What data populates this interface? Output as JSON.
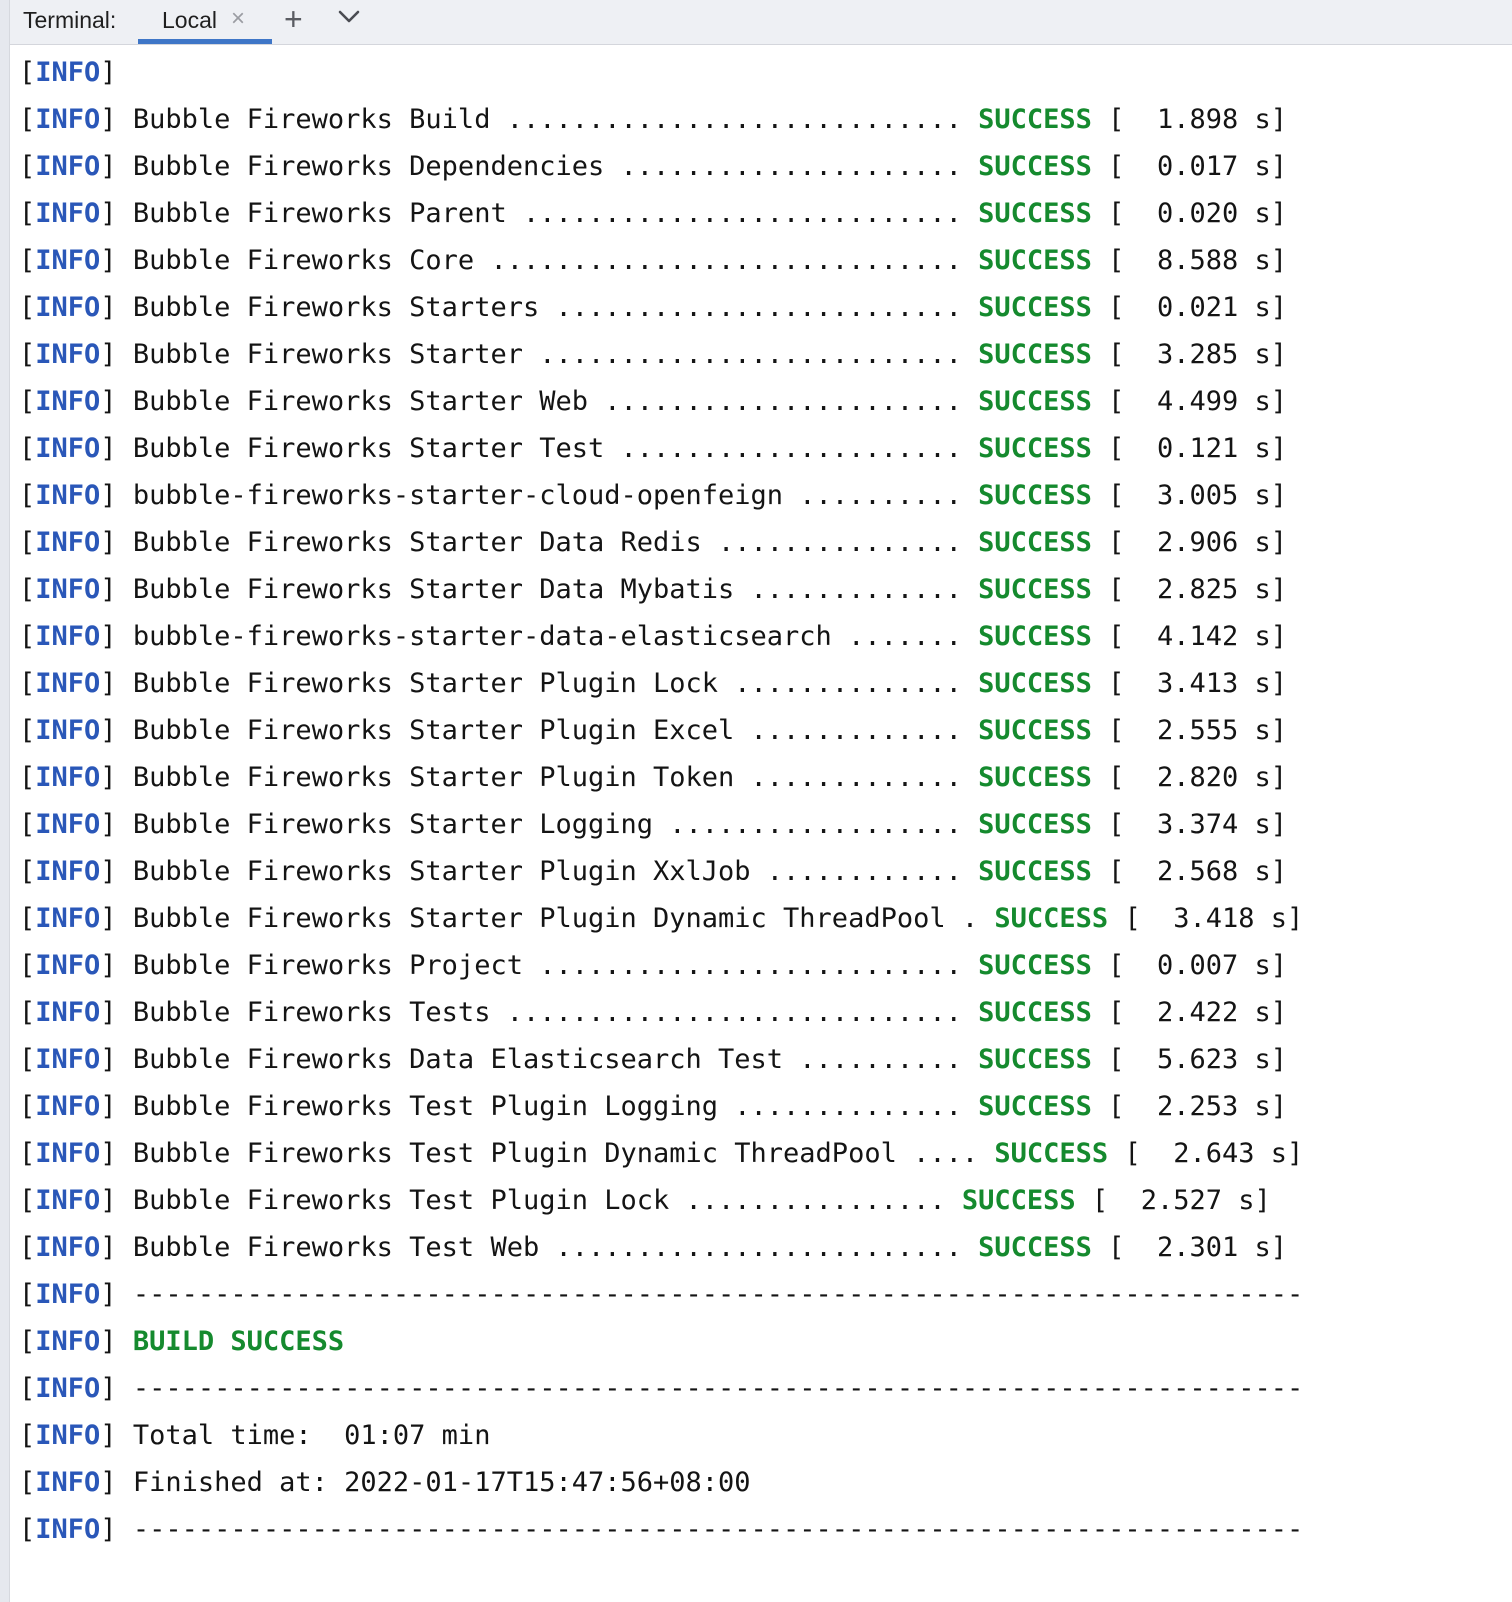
{
  "tabbar": {
    "title": "Terminal:",
    "tab_label": "Local",
    "close_glyph": "×",
    "add_glyph": "+",
    "icons": {
      "close": "close-icon",
      "add": "plus-icon",
      "menu": "chevron-down-icon"
    }
  },
  "colors": {
    "info": "#2a57b8",
    "success": "#158a2e",
    "text": "#141414",
    "tab_underline": "#3e76c7"
  },
  "log": {
    "prefix_open": "[",
    "prefix_word": "INFO",
    "prefix_close": "]",
    "first_line": "",
    "status_word": "SUCCESS",
    "modules": [
      {
        "name": "Bubble Fireworks Build",
        "dots": " ............................ ",
        "time": "1.898 s"
      },
      {
        "name": "Bubble Fireworks Dependencies",
        "dots": " ..................... ",
        "time": "0.017 s"
      },
      {
        "name": "Bubble Fireworks Parent",
        "dots": " ........................... ",
        "time": "0.020 s"
      },
      {
        "name": "Bubble Fireworks Core",
        "dots": " ............................. ",
        "time": "8.588 s"
      },
      {
        "name": "Bubble Fireworks Starters",
        "dots": " ......................... ",
        "time": "0.021 s"
      },
      {
        "name": "Bubble Fireworks Starter",
        "dots": " .......................... ",
        "time": "3.285 s"
      },
      {
        "name": "Bubble Fireworks Starter Web",
        "dots": " ...................... ",
        "time": "4.499 s"
      },
      {
        "name": "Bubble Fireworks Starter Test",
        "dots": " ..................... ",
        "time": "0.121 s"
      },
      {
        "name": "bubble-fireworks-starter-cloud-openfeign",
        "dots": " .......... ",
        "time": "3.005 s"
      },
      {
        "name": "Bubble Fireworks Starter Data Redis",
        "dots": " ............... ",
        "time": "2.906 s"
      },
      {
        "name": "Bubble Fireworks Starter Data Mybatis",
        "dots": " ............. ",
        "time": "2.825 s"
      },
      {
        "name": "bubble-fireworks-starter-data-elasticsearch",
        "dots": " ....... ",
        "time": "4.142 s"
      },
      {
        "name": "Bubble Fireworks Starter Plugin Lock",
        "dots": " .............. ",
        "time": "3.413 s"
      },
      {
        "name": "Bubble Fireworks Starter Plugin Excel",
        "dots": " ............. ",
        "time": "2.555 s"
      },
      {
        "name": "Bubble Fireworks Starter Plugin Token",
        "dots": " ............. ",
        "time": "2.820 s"
      },
      {
        "name": "Bubble Fireworks Starter Logging",
        "dots": " .................. ",
        "time": "3.374 s"
      },
      {
        "name": "Bubble Fireworks Starter Plugin XxlJob",
        "dots": " ............ ",
        "time": "2.568 s"
      },
      {
        "name": "Bubble Fireworks Starter Plugin Dynamic ThreadPool",
        "dots": " . ",
        "time": "3.418 s"
      },
      {
        "name": "Bubble Fireworks Project",
        "dots": " .......................... ",
        "time": "0.007 s"
      },
      {
        "name": "Bubble Fireworks Tests",
        "dots": " ............................ ",
        "time": "2.422 s"
      },
      {
        "name": "Bubble Fireworks Data Elasticsearch Test",
        "dots": " .......... ",
        "time": "5.623 s"
      },
      {
        "name": "Bubble Fireworks Test Plugin Logging",
        "dots": " .............. ",
        "time": "2.253 s"
      },
      {
        "name": "Bubble Fireworks Test Plugin Dynamic ThreadPool",
        "dots": " .... ",
        "time": "2.643 s"
      },
      {
        "name": "Bubble Fireworks Test Plugin Lock",
        "dots": " ................ ",
        "time": "2.527 s"
      },
      {
        "name": "Bubble Fireworks Test Web",
        "dots": " ......................... ",
        "time": "2.301 s"
      }
    ],
    "separator": "------------------------------------------------------------------------",
    "build_result": "BUILD SUCCESS",
    "total_time": "Total time:  01:07 min",
    "finished_at": "Finished at: 2022-01-17T15:47:56+08:00"
  }
}
